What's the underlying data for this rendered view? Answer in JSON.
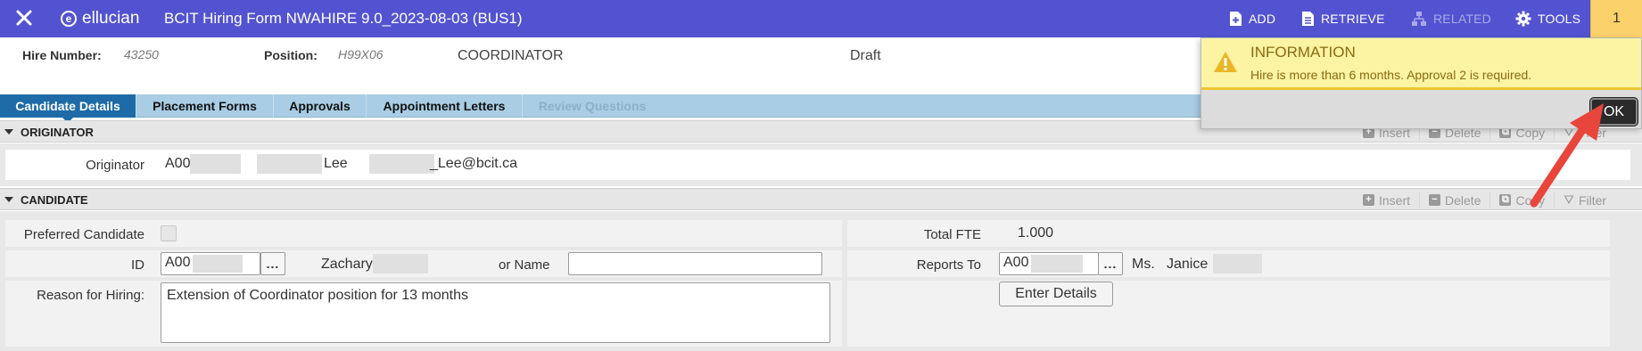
{
  "topbar": {
    "brand": "ellucian",
    "title": "BCIT Hiring Form NWAHIRE 9.0_2023-08-03 (BUS1)",
    "add_label": "ADD",
    "retrieve_label": "RETRIEVE",
    "related_label": "RELATED",
    "tools_label": "TOOLS",
    "notification_count": "1",
    "color": "#5353d1"
  },
  "keyblock": {
    "hire_number_label": "Hire Number:",
    "hire_number_value": "43250",
    "position_label": "Position:",
    "position_value": "H99X06",
    "position_title": "COORDINATOR",
    "status": "Draft"
  },
  "tabs": [
    {
      "label": "Candidate Details",
      "state": "active"
    },
    {
      "label": "Placement Forms",
      "state": "normal"
    },
    {
      "label": "Approvals",
      "state": "normal"
    },
    {
      "label": "Appointment Letters",
      "state": "normal"
    },
    {
      "label": "Review Questions",
      "state": "disabled"
    }
  ],
  "section_actions": {
    "insert": "Insert",
    "delete": "Delete",
    "copy": "Copy",
    "filter": "Filter"
  },
  "originator": {
    "section_title": "ORIGINATOR",
    "label": "Originator",
    "id_prefix": "A00",
    "last_name": "Lee",
    "email_suffix": "_Lee@bcit.ca"
  },
  "candidate": {
    "section_title": "CANDIDATE",
    "preferred_label": "Preferred Candidate",
    "preferred_checked": false,
    "id_label": "ID",
    "id_value": "A00",
    "lov_label": "...",
    "candidate_first_name": "Zachary",
    "or_name_label": "or Name",
    "or_name_value": "",
    "reason_label": "Reason for Hiring:",
    "reason_value": "Extension of Coordinator position for 13 months",
    "total_fte_label": "Total FTE",
    "total_fte_value": "1.000",
    "reports_to_label": "Reports To",
    "reports_to_id": "A00",
    "reports_to_title": "Ms.",
    "reports_to_first_name": "Janice",
    "enter_details_label": "Enter Details"
  },
  "notification": {
    "title": "INFORMATION",
    "message": "Hire is more than 6 months. Approval 2 is required.",
    "ok_label": "OK",
    "bg_color": "#fcf4a3",
    "accent_color": "#f0c433"
  }
}
